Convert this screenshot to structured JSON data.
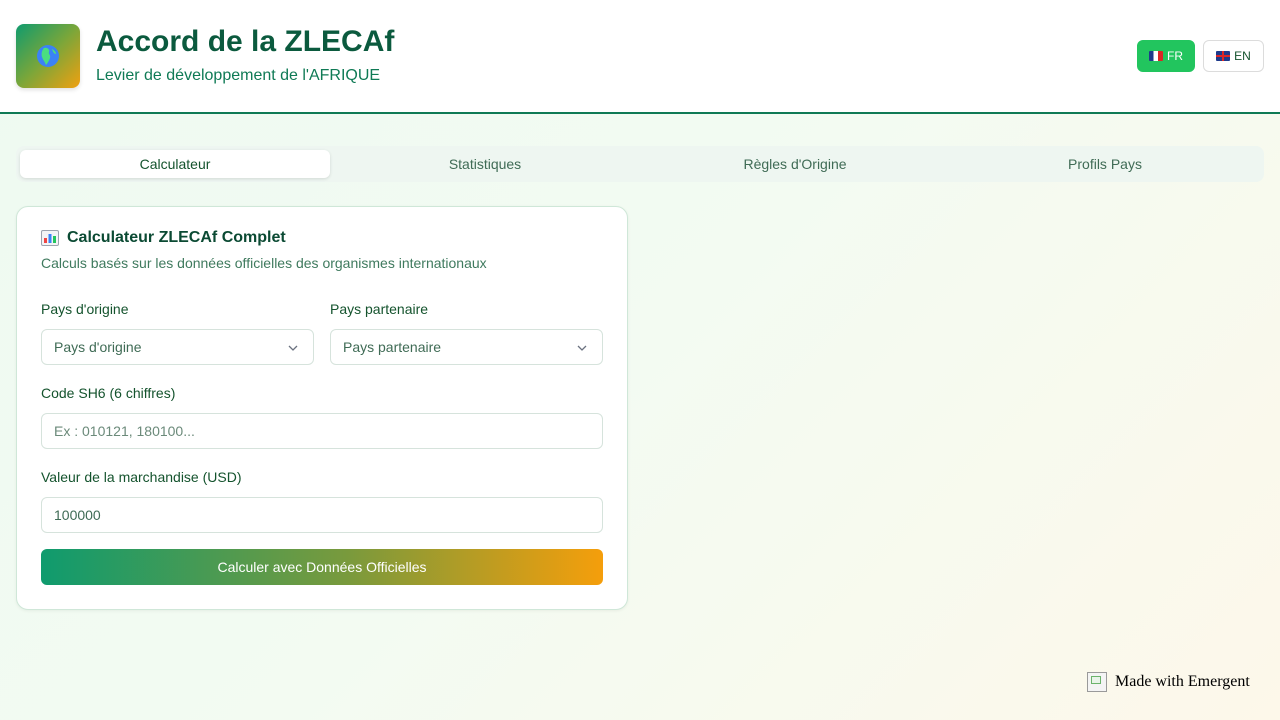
{
  "header": {
    "title": "Accord de la ZLECAf",
    "subtitle": "Levier de développement de l'AFRIQUE",
    "logo_icon": "globe-africa-icon",
    "lang_fr_label": "FR",
    "lang_en_label": "EN"
  },
  "tabs": [
    {
      "label": "Calculateur",
      "active": true
    },
    {
      "label": "Statistiques",
      "active": false
    },
    {
      "label": "Règles d'Origine",
      "active": false
    },
    {
      "label": "Profils Pays",
      "active": false
    }
  ],
  "calculator": {
    "icon": "bar-chart-icon",
    "title": "Calculateur ZLECAf Complet",
    "description": "Calculs basés sur les données officielles des organismes internationaux",
    "origin_label": "Pays d'origine",
    "origin_placeholder": "Pays d'origine",
    "partner_label": "Pays partenaire",
    "partner_placeholder": "Pays partenaire",
    "hs_label": "Code SH6 (6 chiffres)",
    "hs_placeholder": "Ex : 010121, 180100...",
    "value_label": "Valeur de la marchandise (USD)",
    "value": "100000",
    "submit_label": "Calculer avec Données Officielles"
  },
  "footer": {
    "badge_text": "Made with Emergent"
  },
  "colors": {
    "brand_green": "#0f9b6e",
    "brand_orange": "#f59e0b",
    "active_lang": "#22c55e",
    "title_green": "#0b5a3e"
  }
}
